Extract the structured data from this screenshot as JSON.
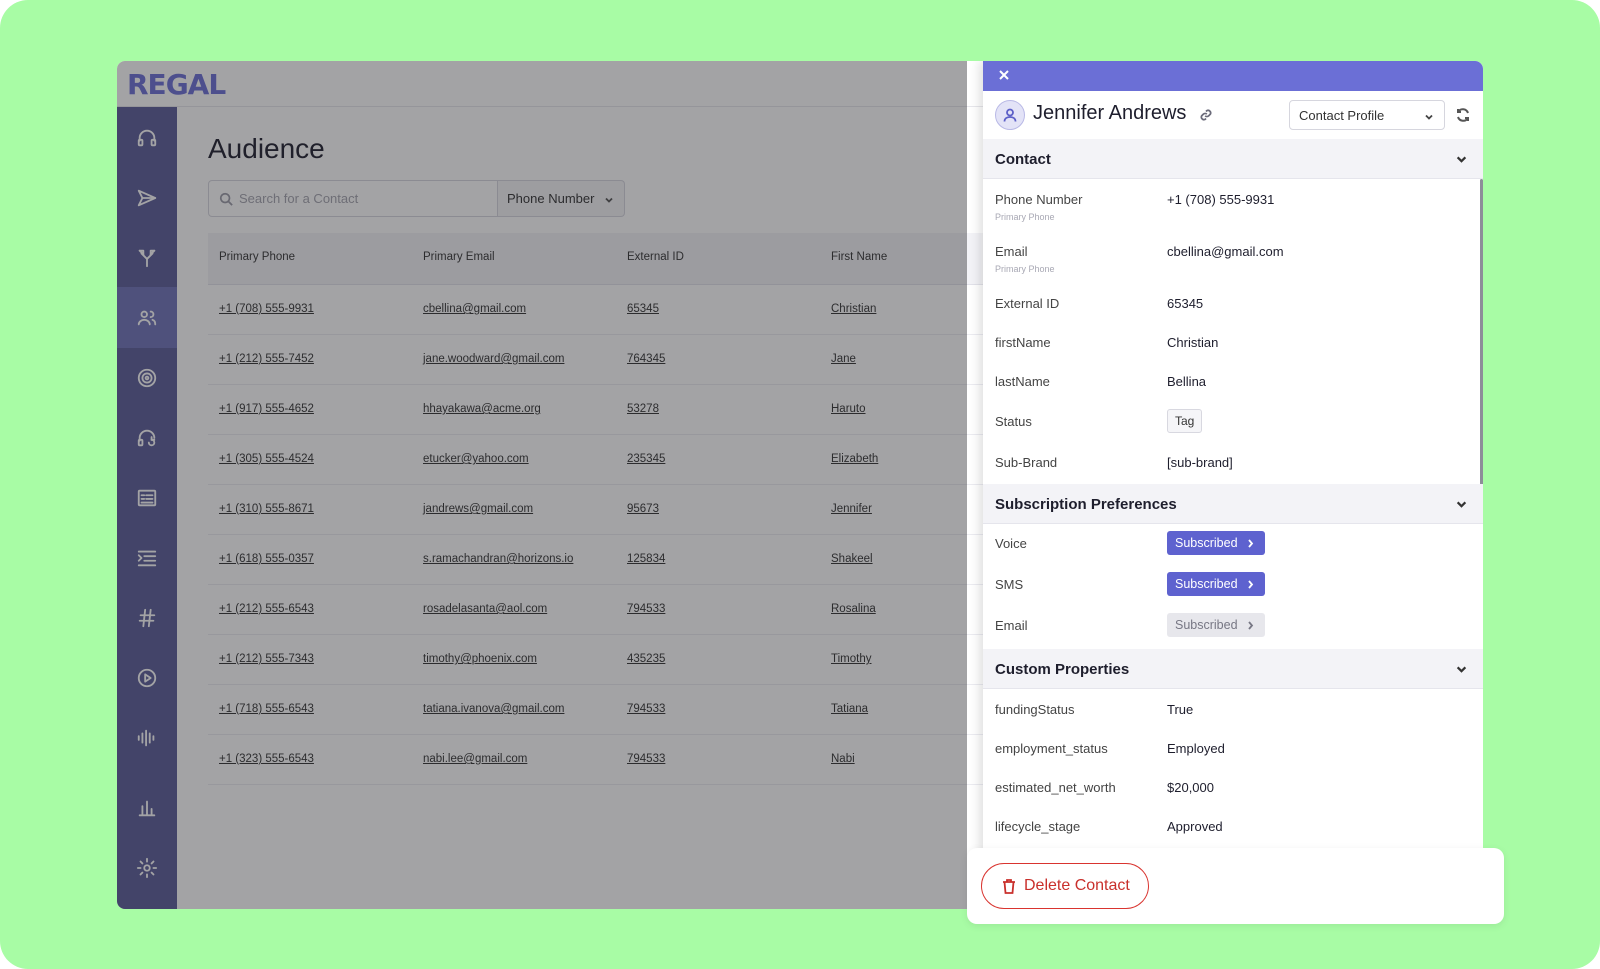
{
  "brand": {
    "logo": "REGAL",
    "accent": "#6b6fd6",
    "sidebar_color": "#5a5c98",
    "background": "#a8fca5"
  },
  "sidebar": {
    "items": [
      {
        "icon": "headset-icon"
      },
      {
        "icon": "send-icon"
      },
      {
        "icon": "split-arrow-icon"
      },
      {
        "icon": "users-icon",
        "active": true
      },
      {
        "icon": "target-icon"
      },
      {
        "icon": "headset-refresh-icon"
      },
      {
        "icon": "form-icon"
      },
      {
        "icon": "list-icon"
      },
      {
        "icon": "hash-icon"
      },
      {
        "icon": "play-circle-icon"
      },
      {
        "icon": "waveform-icon"
      },
      {
        "icon": "bar-chart-icon"
      },
      {
        "icon": "gear-icon"
      }
    ]
  },
  "audience": {
    "title": "Audience",
    "search_placeholder": "Search for a Contact",
    "filter_label": "Phone Number",
    "columns": [
      "Primary Phone",
      "Primary Email",
      "External ID",
      "First Name"
    ],
    "rows": [
      {
        "phone": "+1 (708) 555-9931",
        "email": "cbellina@gmail.com",
        "external_id": "65345",
        "first_name": "Christian"
      },
      {
        "phone": "+1 (212) 555-7452",
        "email": "jane.woodward@gmail.com",
        "external_id": "764345",
        "first_name": "Jane"
      },
      {
        "phone": "+1 (917) 555-4652",
        "email": "hhayakawa@acme.org",
        "external_id": "53278",
        "first_name": "Haruto"
      },
      {
        "phone": "+1 (305) 555-4524",
        "email": "etucker@yahoo.com",
        "external_id": "235345",
        "first_name": "Elizabeth"
      },
      {
        "phone": "+1 (310) 555-8671",
        "email": "jandrews@gmail.com",
        "external_id": "95673",
        "first_name": "Jennifer"
      },
      {
        "phone": "+1 (618) 555-0357",
        "email": "s.ramachandran@horizons.io",
        "external_id": "125834",
        "first_name": "Shakeel"
      },
      {
        "phone": "+1 (212) 555-6543",
        "email": "rosadelasanta@aol.com",
        "external_id": "794533",
        "first_name": "Rosalina"
      },
      {
        "phone": "+1 (212) 555-7343",
        "email": "timothy@phoenix.com",
        "external_id": "435235",
        "first_name": "Timothy"
      },
      {
        "phone": "+1 (718) 555-6543",
        "email": "tatiana.ivanova@gmail.com",
        "external_id": "794533",
        "first_name": "Tatiana"
      },
      {
        "phone": "+1 (323) 555-6543",
        "email": "nabi.lee@gmail.com",
        "external_id": "794533",
        "first_name": "Nabi"
      }
    ]
  },
  "panel": {
    "contact_name": "Jennifer Andrews",
    "view_select": "Contact Profile",
    "contact_section": {
      "title": "Contact",
      "phone_label": "Phone Number",
      "phone_sub": "Primary Phone",
      "phone_value": "+1 (708) 555-9931",
      "email_label": "Email",
      "email_sub": "Primary Phone",
      "email_value": "cbellina@gmail.com",
      "external_id_label": "External ID",
      "external_id_value": "65345",
      "first_name_label": "firstName",
      "first_name_value": "Christian",
      "last_name_label": "lastName",
      "last_name_value": "Bellina",
      "status_label": "Status",
      "status_value": "Tag",
      "sub_brand_label": "Sub-Brand",
      "sub_brand_value": "[sub-brand]"
    },
    "subscription_section": {
      "title": "Subscription Preferences",
      "voice_label": "Voice",
      "voice_value": "Subscribed",
      "sms_label": "SMS",
      "sms_value": "Subscribed",
      "email_label": "Email",
      "email_value": "Subscribed"
    },
    "custom_section": {
      "title": "Custom Properties",
      "funding_label": "fundingStatus",
      "funding_value": "True",
      "employment_label": "employment_status",
      "employment_value": "Employed",
      "net_worth_label": "estimated_net_worth",
      "net_worth_value": "$20,000",
      "lifecycle_label": "lifecycle_stage",
      "lifecycle_value": "Approved"
    },
    "delete_label": "Delete Contact",
    "delete_color": "#c9302c"
  }
}
